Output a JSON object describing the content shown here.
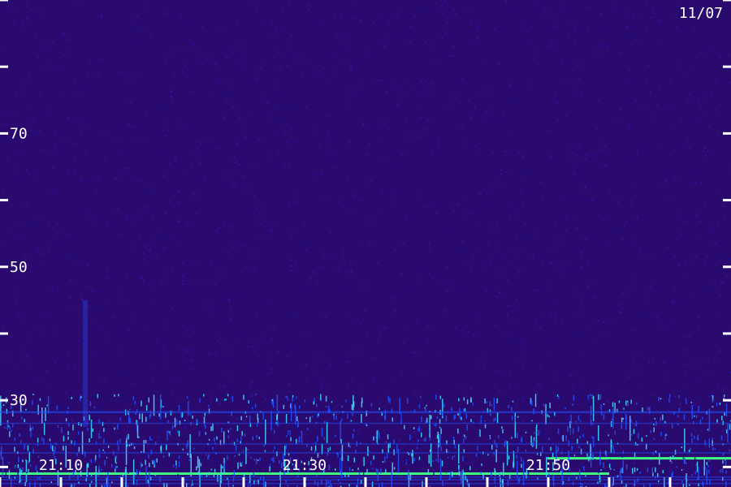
{
  "chart_data": {
    "type": "heatmap",
    "date_label": "11/07",
    "y_ticks": [
      {
        "value": 20,
        "label": ""
      },
      {
        "value": 30,
        "label": "30"
      },
      {
        "value": 40,
        "label": ""
      },
      {
        "value": 50,
        "label": "50"
      },
      {
        "value": 60,
        "label": ""
      },
      {
        "value": 70,
        "label": "70"
      },
      {
        "value": 80,
        "label": ""
      },
      {
        "value": 90,
        "label": ""
      }
    ],
    "y_range": [
      17,
      90
    ],
    "x_ticks": [
      {
        "value": "21:05",
        "label": ""
      },
      {
        "value": "21:10",
        "label": "21:10"
      },
      {
        "value": "21:15",
        "label": ""
      },
      {
        "value": "21:20",
        "label": ""
      },
      {
        "value": "21:25",
        "label": ""
      },
      {
        "value": "21:30",
        "label": "21:30"
      },
      {
        "value": "21:35",
        "label": ""
      },
      {
        "value": "21:40",
        "label": ""
      },
      {
        "value": "21:45",
        "label": ""
      },
      {
        "value": "21:50",
        "label": "21:50"
      },
      {
        "value": "21:55",
        "label": ""
      },
      {
        "value": "22:00",
        "label": ""
      }
    ],
    "x_range": [
      "21:05",
      "22:05"
    ],
    "colormap": {
      "background": "#2a0a6e",
      "low": "#1a0a8c",
      "mid": "#2050ff",
      "high": "#40e0ff",
      "peak": "#40ff80"
    },
    "features": [
      {
        "kind": "horizontal-line",
        "y": 19.0,
        "x_start": "21:05",
        "x_end": "21:55",
        "intensity": "peak"
      },
      {
        "kind": "horizontal-line",
        "y": 21.3,
        "x_start": "21:50",
        "x_end": "22:05",
        "intensity": "peak"
      },
      {
        "kind": "noise-band",
        "y_start": 17,
        "y_end": 31,
        "intensity": "high"
      },
      {
        "kind": "vertical-streak",
        "x": "21:12",
        "y_start": 26,
        "y_end": 45,
        "intensity": "mid"
      }
    ],
    "grid": false,
    "legend": "none"
  }
}
